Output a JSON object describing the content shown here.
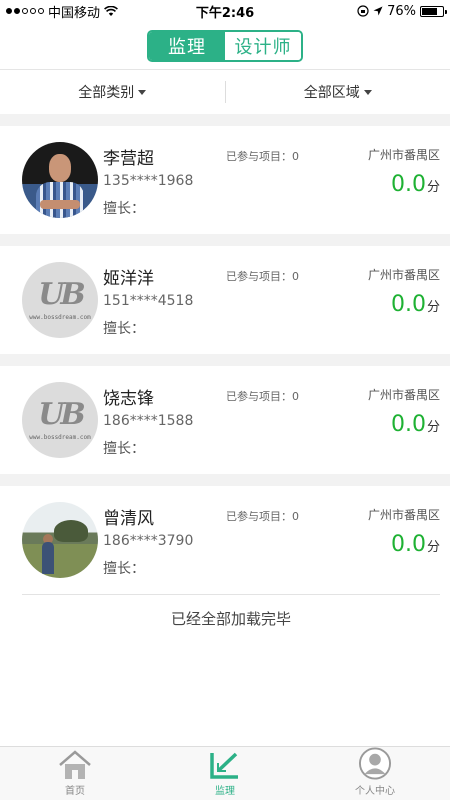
{
  "status_bar": {
    "carrier": "中国移动",
    "time": "下午2:46",
    "battery": "76%",
    "battery_level": 0.76
  },
  "header": {
    "tabs": [
      {
        "label": "监理",
        "active": true
      },
      {
        "label": "设计师",
        "active": false
      }
    ]
  },
  "filters": {
    "category": "全部类别",
    "region": "全部区域"
  },
  "supervisors": [
    {
      "name": "李营超",
      "projects": "已参与项目：0",
      "region": "广州市番禺区",
      "phone": "135****1968",
      "score": "0.0",
      "unit": "分",
      "skill": "擅长：",
      "avatar": "photo-man-plaid-shirt"
    },
    {
      "name": "姬洋洋",
      "projects": "已参与项目：0",
      "region": "广州市番禺区",
      "phone": "151****4518",
      "score": "0.0",
      "unit": "分",
      "skill": "擅长：",
      "avatar": "default-logo",
      "avatar_mark": "UB",
      "avatar_watermark": "www.bossdream.com"
    },
    {
      "name": "饶志锋",
      "projects": "已参与项目：0",
      "region": "广州市番禺区",
      "phone": "186****1588",
      "score": "0.0",
      "unit": "分",
      "skill": "擅长：",
      "avatar": "default-logo",
      "avatar_mark": "UB",
      "avatar_watermark": "www.bossdream.com"
    },
    {
      "name": "曾清风",
      "projects": "已参与项目：0",
      "region": "广州市番禺区",
      "phone": "186****3790",
      "score": "0.0",
      "unit": "分",
      "skill": "擅长：",
      "avatar": "photo-man-outdoors"
    }
  ],
  "end_text": "已经全部加载完毕",
  "tab_bar": [
    {
      "label": "首页",
      "icon": "home-icon",
      "active": false
    },
    {
      "label": "监理",
      "icon": "ruler-icon",
      "active": true
    },
    {
      "label": "个人中心",
      "icon": "profile-icon",
      "active": false
    }
  ],
  "colors": {
    "accent": "#2cb187",
    "score": "#1eb133"
  }
}
